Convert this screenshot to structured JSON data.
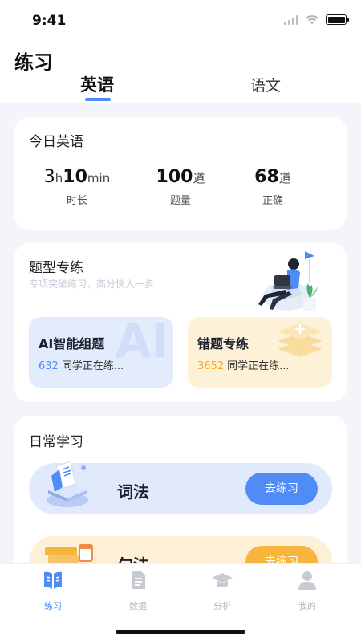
{
  "status_bar": {
    "time": "9:41"
  },
  "header": {
    "title": "练习",
    "tabs": [
      {
        "label": "英语",
        "active": true
      },
      {
        "label": "语文",
        "active": false
      }
    ]
  },
  "today": {
    "title": "今日英语",
    "duration": {
      "hours": "3",
      "hours_unit": "h",
      "minutes": "10",
      "minutes_unit": "min",
      "label": "时长"
    },
    "count": {
      "value": "100",
      "unit": "道",
      "label": "题量"
    },
    "correct": {
      "value": "68",
      "unit": "道",
      "label": "正确"
    }
  },
  "practice": {
    "title": "题型专练",
    "subtitle": "专项突破练习，高分快人一步",
    "ai": {
      "title": "AI智能组题",
      "count": "632",
      "meta": "同学正在练...",
      "watermark": "AI"
    },
    "wrong": {
      "title": "错题专练",
      "count": "3652",
      "meta": "同学正在练..."
    }
  },
  "daily": {
    "title": "日常学习",
    "rows": [
      {
        "label": "词法",
        "button": "去练习"
      },
      {
        "label": "句法",
        "button": "去练习"
      }
    ]
  },
  "tabbar": [
    {
      "label": "练习",
      "icon": "book-icon",
      "active": true
    },
    {
      "label": "数据",
      "icon": "document-icon",
      "active": false
    },
    {
      "label": "分析",
      "icon": "graduation-cap-icon",
      "active": false
    },
    {
      "label": "我的",
      "icon": "person-icon",
      "active": false
    }
  ],
  "colors": {
    "accent": "#4f8cf7",
    "gold": "#f6b63e",
    "background": "#f3f5fb"
  }
}
